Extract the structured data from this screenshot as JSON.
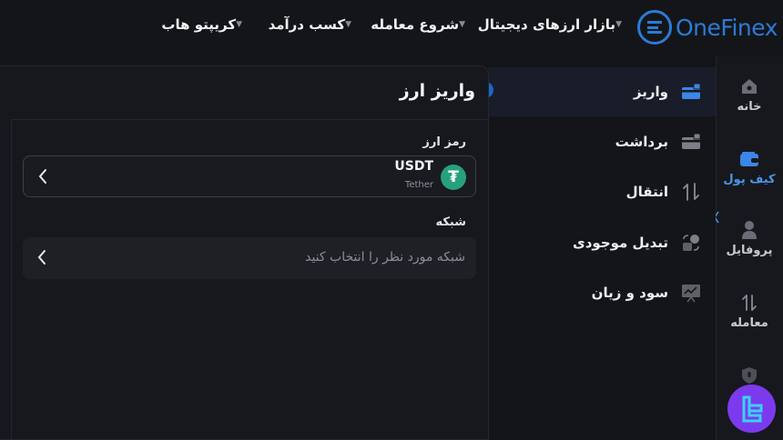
{
  "brand": {
    "name": "OneFinex",
    "color": "#2b7bd6"
  },
  "nav": [
    {
      "label": "بازار ارزهای دیجیتال"
    },
    {
      "label": "شروع معامله"
    },
    {
      "label": "کسب درآمد"
    },
    {
      "label": "کریپتو هاب"
    }
  ],
  "rail": [
    {
      "label": "خانه",
      "icon": "home-icon"
    },
    {
      "label": "کیف پول",
      "icon": "wallet-icon",
      "active": true
    },
    {
      "label": "پروفایل",
      "icon": "user-icon"
    },
    {
      "label": "معامله",
      "icon": "trade-arrows-icon"
    },
    {
      "label": "",
      "icon": "shield-icon"
    }
  ],
  "menu": [
    {
      "label": "واریز",
      "icon": "deposit-card-icon",
      "active": true
    },
    {
      "label": "برداشت",
      "icon": "withdraw-card-icon"
    },
    {
      "label": "انتقال",
      "icon": "transfer-arrows-icon"
    },
    {
      "label": "تبدیل موجودی",
      "icon": "convert-icon"
    },
    {
      "label": "سود و زیان",
      "icon": "pnl-chart-icon"
    }
  ],
  "panel": {
    "title": "واریز ارز",
    "coin_label": "رمز ارز",
    "coin_symbol": "USDT",
    "coin_name": "Tether",
    "network_label": "شبکه",
    "network_placeholder": "شبکه مورد نظر را انتخاب کنید"
  },
  "colors": {
    "accent": "#4c95ea",
    "tether": "#26a17b",
    "badge": "#7c3aed"
  }
}
